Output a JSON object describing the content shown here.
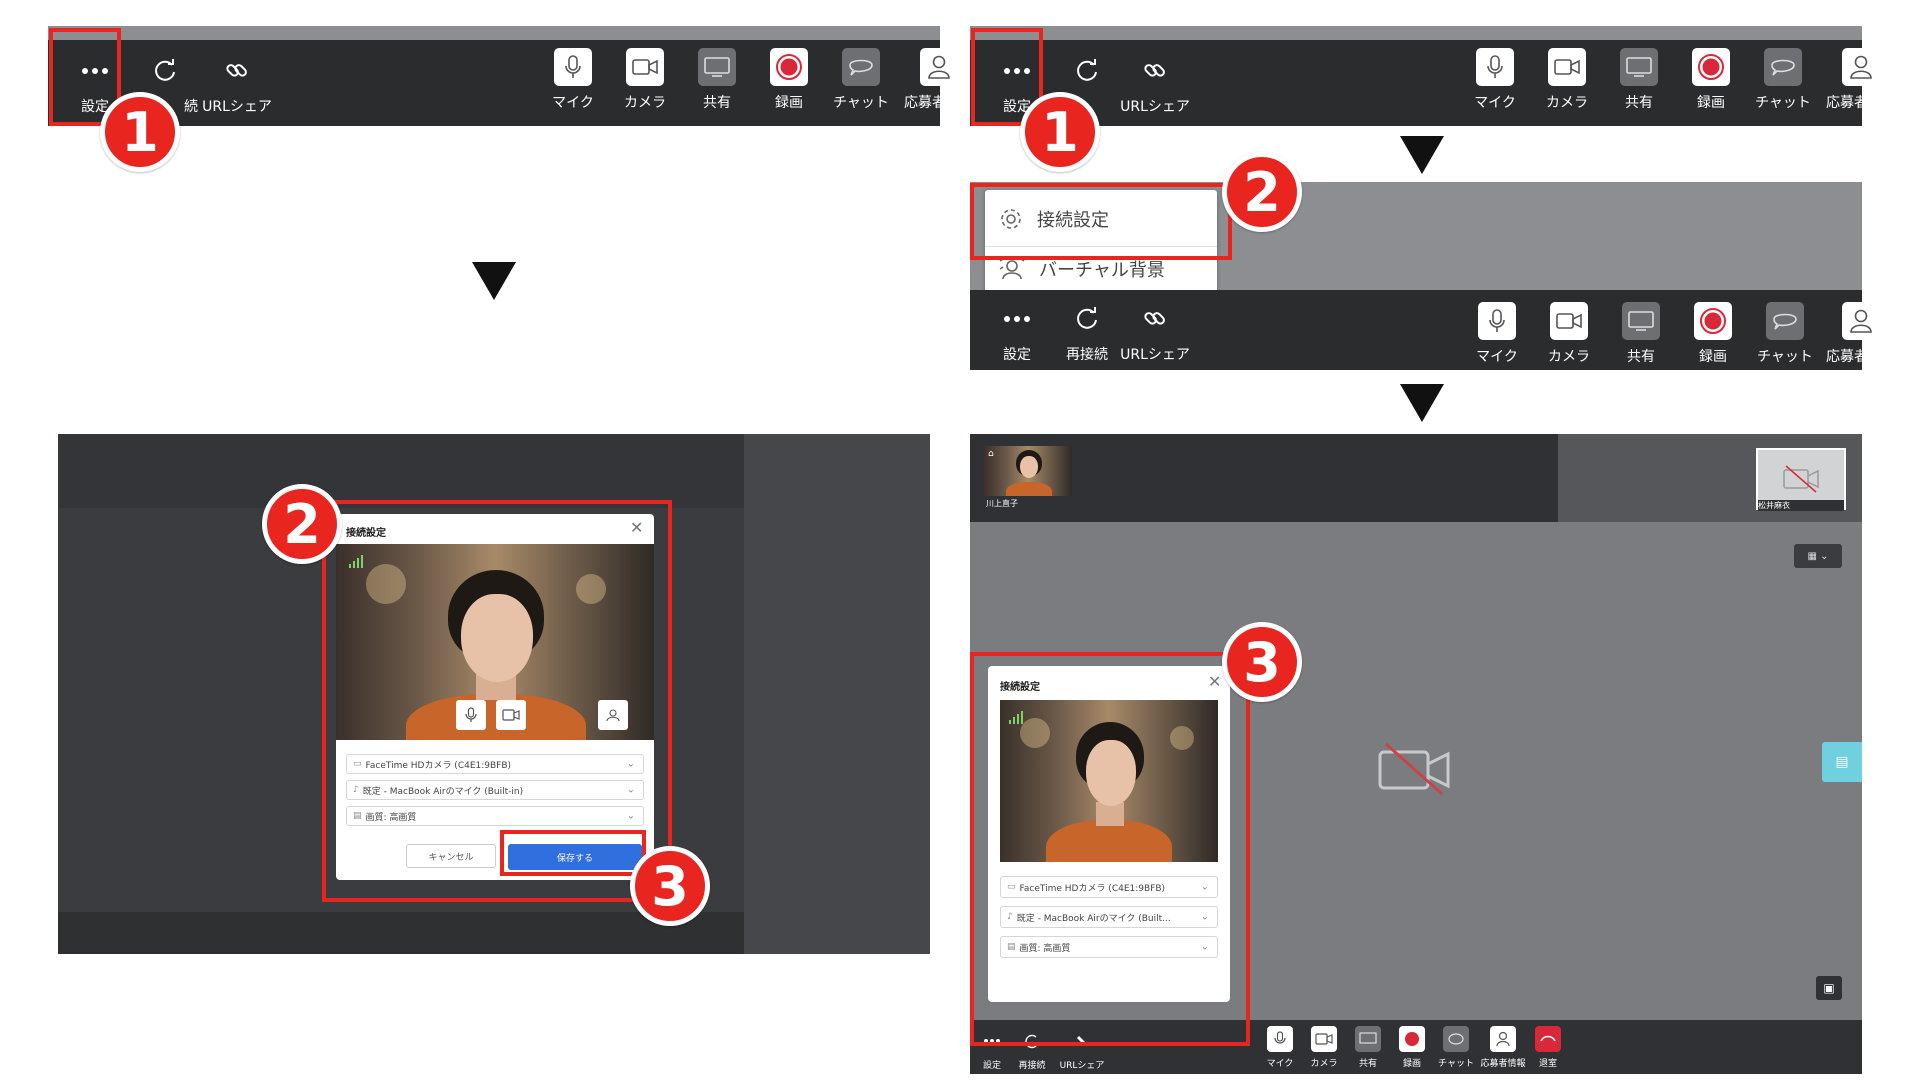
{
  "toolbar_full": {
    "settings": "設定",
    "reconnect": "再接続",
    "url_share": "URLシェア",
    "mic": "マイク",
    "camera": "カメラ",
    "share": "共有",
    "record": "録画",
    "chat": "チャット",
    "applicant_info": "応募者情報"
  },
  "toolbar_partial": {
    "reconnect_fragment": "続"
  },
  "menu": {
    "connection_settings": "接続設定",
    "virtual_background": "バーチャル背景"
  },
  "badges": {
    "one": "1",
    "two": "2",
    "three": "3"
  },
  "dialog": {
    "title": "接続設定",
    "camera_select": "FaceTime HDカメラ (C4E1:9BFB)",
    "mic_select": "既定 - MacBook Airのマイク (Built-in)",
    "mic_select_short": "既定 - MacBook Airのマイク (Built...",
    "quality_select": "画質: 高画質",
    "cancel": "キャンセル",
    "save": "保存する"
  },
  "participants": {
    "left_name": "川上直子",
    "right_name": "松井麻衣"
  },
  "toolbar_small": {
    "settings": "設定",
    "reconnect": "再接続",
    "url_share": "URLシェア",
    "mic": "マイク",
    "camera": "カメラ",
    "share": "共有",
    "record": "録画",
    "chat": "チャット",
    "applicant_info": "応募者情報",
    "leave": "退室"
  },
  "colors": {
    "accent_red": "#e8251f",
    "toolbar_bg": "#2b2c2e",
    "save_blue": "#2f6fde",
    "record_red": "#d8283a"
  }
}
